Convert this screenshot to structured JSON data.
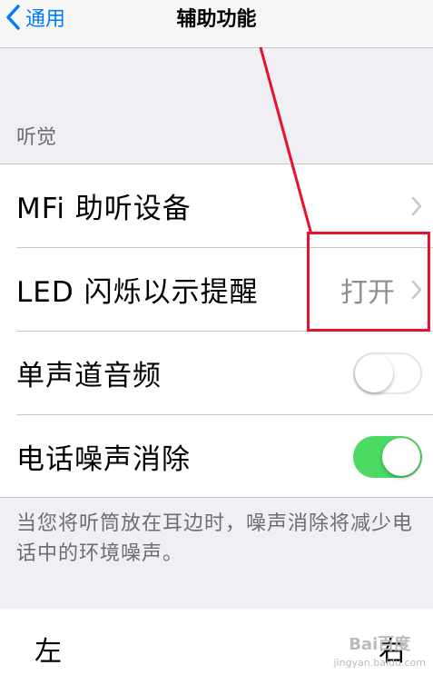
{
  "navbar": {
    "back_label": "通用",
    "title": "辅助功能"
  },
  "section": {
    "header": "听觉"
  },
  "rows": [
    {
      "label": "MFi 助听设备",
      "value": "",
      "control": "chevron"
    },
    {
      "label": "LED 闪烁以示提醒",
      "value": "打开",
      "control": "chevron"
    },
    {
      "label": "单声道音频",
      "control": "toggle",
      "on": false
    },
    {
      "label": "电话噪声消除",
      "control": "toggle",
      "on": true
    }
  ],
  "footer_note": "当您将听筒放在耳边时，噪声消除将减少电话中的环境噪声。",
  "bottom": {
    "left_label": "左",
    "right_label": "右"
  },
  "watermark": {
    "brand": "Bai百度",
    "sub": "jingyan.baidu.com"
  },
  "colors": {
    "accent": "#007aff",
    "toggle_on": "#4cd964",
    "annotation": "#e8102c"
  }
}
